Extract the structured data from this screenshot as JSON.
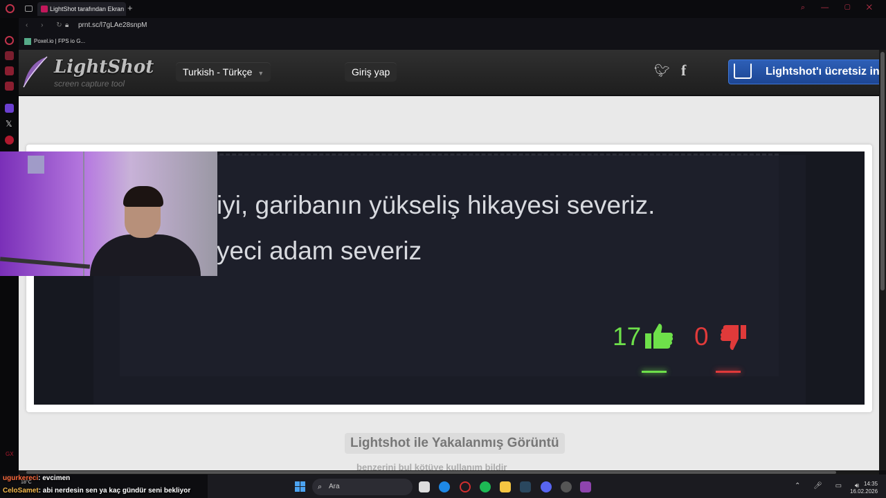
{
  "browser": {
    "tab_title": "LightShot tarafından Ekran",
    "new_tab": "+",
    "url": "prnt.sc/l7gLAe28snpM",
    "bookmark": "Poxel.io | FPS io G..."
  },
  "lightshot": {
    "logo": "LightShot",
    "logo_sub": "screen capture tool",
    "language": "Turkish - Türkçe",
    "login": "Giriş yap",
    "download": "Lightshot'ı ücretsiz in"
  },
  "screenshot": {
    "line1": "iyi, garibanın yükseliş hikayesi severiz.",
    "line2": "yeci adam severiz",
    "likes": "17",
    "dislikes": "0"
  },
  "page": {
    "capture_title": "Lightshot ile Yakalanmış Görüntü",
    "sub_links": "benzerini bul   kötüye kullanım bildir"
  },
  "chat": [
    {
      "user": "ugurkereci",
      "text": ": evcimen"
    },
    {
      "user": "CeloSamet",
      "text": ": abi nerdesin sen ya kaç gündür seni bekliyor"
    }
  ],
  "weather": "18°C",
  "taskbar": {
    "search_placeholder": "Ara",
    "time": "14:35",
    "date": "16.02.2026"
  },
  "colors": {
    "like": "#6ee04a",
    "dislike": "#e03a3a",
    "download_button": "#2d5fb7"
  }
}
